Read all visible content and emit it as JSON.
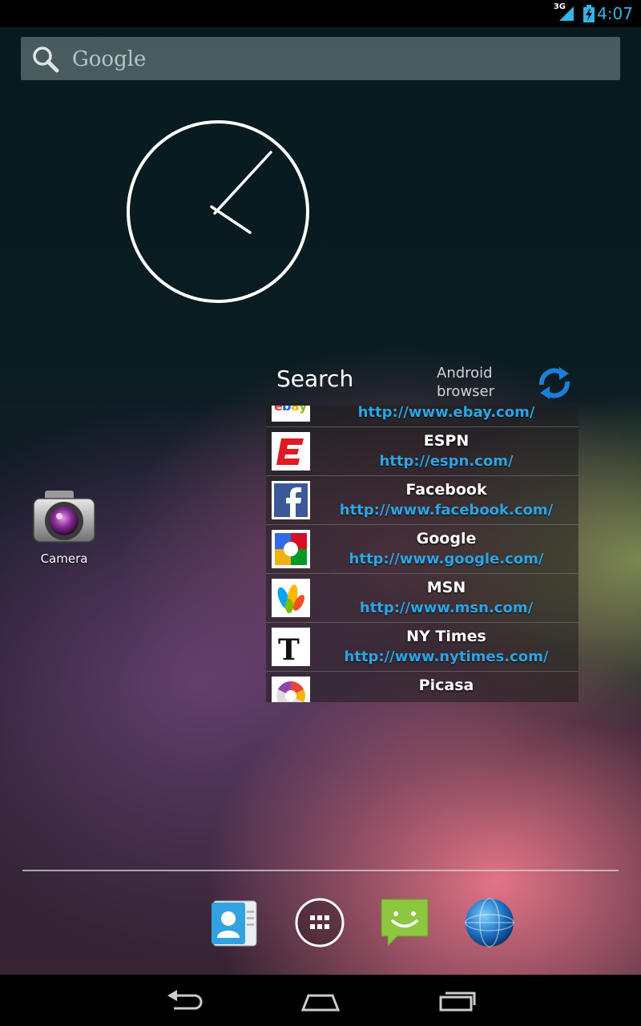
{
  "status_bar": {
    "network_type": "3G",
    "time": "4:07",
    "accent_color": "#33b5e5"
  },
  "search_bar": {
    "placeholder": "Google",
    "icon": "search-icon"
  },
  "clock_widget": {
    "hour_hand_icon": "clock-hand",
    "time_shown": "4:07"
  },
  "home_shortcuts": [
    {
      "label": "Camera",
      "icon": "camera-icon"
    }
  ],
  "bookmarks_widget": {
    "title": "Search",
    "source_line1": "Android",
    "source_line2": "browser",
    "refresh_icon": "refresh-icon",
    "items": [
      {
        "name": "eBay",
        "url": "http://www.ebay.com/",
        "icon": "ebay-favicon"
      },
      {
        "name": "ESPN",
        "url": "http://espn.com/",
        "icon": "espn-favicon"
      },
      {
        "name": "Facebook",
        "url": "http://www.facebook.com/",
        "icon": "facebook-favicon"
      },
      {
        "name": "Google",
        "url": "http://www.google.com/",
        "icon": "google-favicon"
      },
      {
        "name": "MSN",
        "url": "http://www.msn.com/",
        "icon": "msn-favicon"
      },
      {
        "name": "NY Times",
        "url": "http://www.nytimes.com/",
        "icon": "nytimes-favicon"
      },
      {
        "name": "Picasa",
        "url": "",
        "icon": "picasa-favicon"
      }
    ]
  },
  "dock": [
    {
      "icon": "contacts-icon"
    },
    {
      "icon": "all-apps-icon"
    },
    {
      "icon": "messaging-icon"
    },
    {
      "icon": "browser-icon"
    }
  ],
  "nav_bar": [
    {
      "icon": "back-icon"
    },
    {
      "icon": "home-icon"
    },
    {
      "icon": "recents-icon"
    }
  ]
}
